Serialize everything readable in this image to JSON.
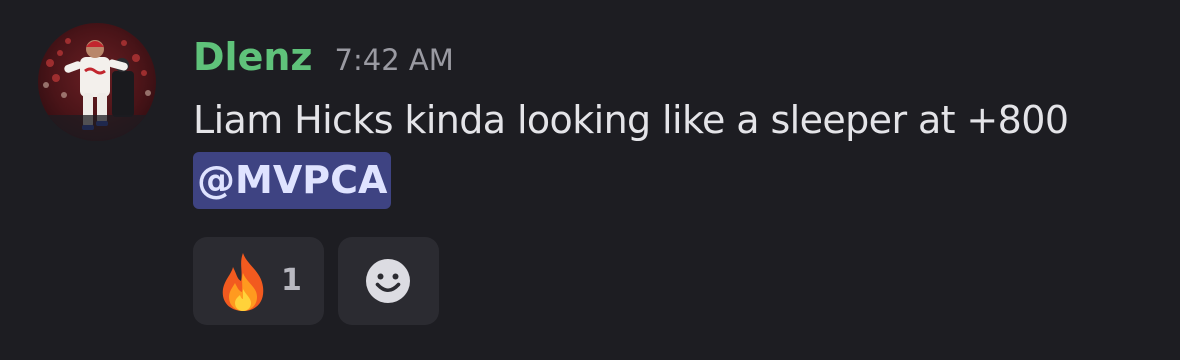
{
  "message": {
    "username": "Dlenz",
    "timestamp": "7:42 AM",
    "text": "Liam Hicks kinda looking like a sleeper at +800",
    "mention": "@MVPCA",
    "avatar": {
      "icon": "baseball-player-avatar"
    }
  },
  "reactions": [
    {
      "emoji": "fire-emoji",
      "count": "1"
    }
  ],
  "add_reaction": {
    "icon": "smile-icon"
  },
  "colors": {
    "background": "#1d1d22",
    "username": "#5fc27a",
    "mention_bg": "#3e4382",
    "reaction_bg": "#2b2b31"
  }
}
